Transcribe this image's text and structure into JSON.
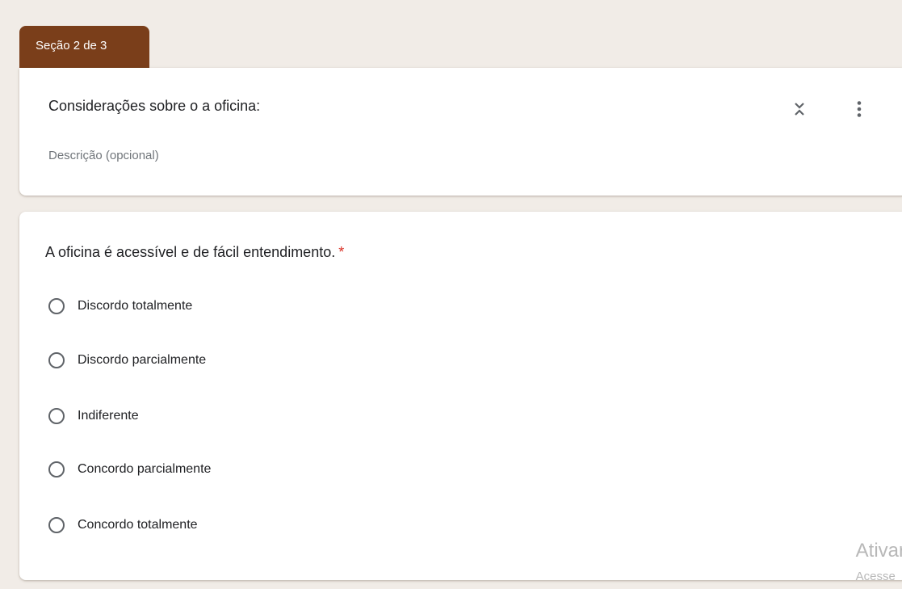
{
  "section": {
    "tab_label": "Seção 2 de 3",
    "title": "Considerações sobre o a oficina:",
    "description_placeholder": "Descrição (opcional)",
    "accent_color": "#7a3e1a"
  },
  "question": {
    "title": "A oficina é acessível e de fácil entendimento.",
    "required_mark": "*",
    "options": [
      {
        "label": "Discordo totalmente"
      },
      {
        "label": "Discordo parcialmente"
      },
      {
        "label": "Indiferente"
      },
      {
        "label": "Concordo parcialmente"
      },
      {
        "label": "Concordo totalmente"
      }
    ]
  },
  "watermark": {
    "line1": "Ativar",
    "line2": "Acesse"
  },
  "icons": {
    "collapse": "collapse-expand-icon",
    "more": "more-vert-icon"
  }
}
